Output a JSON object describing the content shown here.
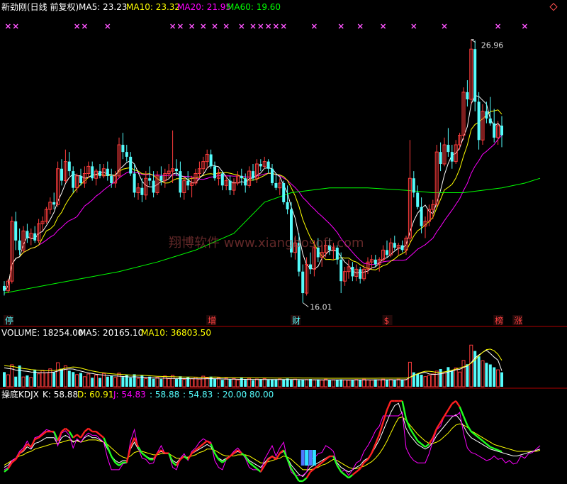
{
  "colors": {
    "bg": "#000000",
    "up": "#ff3c3c",
    "down": "#54fcfc",
    "ma5": "#ffffff",
    "ma10": "#ffff00",
    "ma20": "#ff00ff",
    "ma60": "#00ff00",
    "divider": "#b00000",
    "marker": "#ff55ff",
    "kdj_red": "#ff2020",
    "kdj_green": "#20ff20",
    "kdj_blue": "#5078ff",
    "watermark": "#a05050"
  },
  "header": {
    "name": "新劲刚(日线 前复权)",
    "ma5": "MA5: 23.23",
    "ma10": "MA10: 23.32",
    "ma20": "MA20: 21.95",
    "ma60": "MA60: 19.60"
  },
  "price_panel": {
    "high_label": "26.96",
    "low_label": "16.01",
    "watermark": "翔博软件 www.xiangbosoft.com",
    "event_markers": [
      {
        "label": "停",
        "x_index": 0,
        "color": "#54fcfc"
      },
      {
        "label": "增",
        "x_index": 53,
        "color": "#ff4040"
      },
      {
        "label": "财",
        "x_index": 75,
        "color": "#54fcfc"
      },
      {
        "label": "$",
        "x_index": 99,
        "color": "#ff4040"
      },
      {
        "label": "榜",
        "x_index": 128,
        "color": "#ff4040"
      },
      {
        "label": "涨",
        "x_index": 133,
        "color": "#ff4040"
      }
    ],
    "cross_marker_indices": [
      1,
      3,
      19,
      21,
      27,
      44,
      46,
      49,
      52,
      55,
      58,
      62,
      65,
      67,
      69,
      71,
      73,
      81,
      88,
      93,
      99,
      107,
      115,
      129,
      136
    ]
  },
  "volume_panel": {
    "label": "VOLUME: 18254.00",
    "ma5": "MA5: 20165.10",
    "ma10": "MA10: 36803.50"
  },
  "kdj_panel": {
    "title": "操底KDJX",
    "k": "K: 58.88",
    "d": "D: 60.91",
    "j": "J: 54.83",
    "v1": ": 58.88",
    "v2": ": 54.83",
    "v3": ": 20.00",
    "v4": ": 80.00"
  },
  "chart_data": {
    "type": "candlestick",
    "series_count": 141,
    "ohlc_price_range": [
      15.6,
      28.0
    ],
    "candles": [
      [
        16.7,
        16.9,
        16.3,
        16.5
      ],
      [
        16.5,
        17.0,
        16.4,
        16.9
      ],
      [
        16.9,
        19.6,
        16.8,
        19.4
      ],
      [
        19.4,
        19.8,
        18.2,
        18.6
      ],
      [
        18.6,
        19.1,
        18.0,
        18.2
      ],
      [
        18.2,
        19.2,
        18.1,
        19.0
      ],
      [
        19.0,
        19.3,
        18.5,
        18.7
      ],
      [
        18.7,
        19.1,
        18.4,
        18.9
      ],
      [
        18.9,
        19.2,
        18.5,
        18.6
      ],
      [
        18.6,
        19.5,
        18.5,
        19.3
      ],
      [
        19.3,
        19.6,
        19.0,
        19.4
      ],
      [
        19.4,
        20.0,
        19.3,
        19.9
      ],
      [
        19.9,
        20.4,
        19.7,
        20.2
      ],
      [
        20.2,
        20.6,
        19.9,
        20.1
      ],
      [
        20.1,
        21.9,
        20.0,
        21.6
      ],
      [
        21.6,
        22.0,
        20.9,
        21.1
      ],
      [
        21.1,
        22.4,
        21.0,
        21.9
      ],
      [
        21.9,
        22.3,
        21.3,
        21.5
      ],
      [
        21.5,
        21.7,
        20.6,
        20.8
      ],
      [
        20.8,
        21.4,
        20.6,
        21.3
      ],
      [
        21.3,
        21.6,
        20.9,
        21.0
      ],
      [
        21.0,
        21.7,
        20.8,
        21.4
      ],
      [
        21.4,
        21.9,
        21.2,
        21.7
      ],
      [
        21.7,
        21.9,
        21.1,
        21.2
      ],
      [
        21.2,
        21.6,
        20.9,
        21.5
      ],
      [
        21.5,
        21.8,
        21.2,
        21.3
      ],
      [
        21.3,
        21.8,
        21.2,
        21.6
      ],
      [
        21.6,
        21.9,
        21.1,
        21.3
      ],
      [
        21.3,
        21.6,
        20.8,
        21.0
      ],
      [
        21.0,
        21.5,
        20.8,
        21.3
      ],
      [
        21.3,
        22.9,
        21.2,
        22.6
      ],
      [
        22.6,
        23.1,
        22.0,
        22.3
      ],
      [
        22.3,
        22.6,
        21.9,
        22.1
      ],
      [
        22.1,
        22.3,
        21.3,
        21.4
      ],
      [
        21.4,
        21.8,
        20.4,
        20.6
      ],
      [
        20.6,
        21.0,
        20.3,
        20.8
      ],
      [
        20.8,
        21.2,
        20.2,
        20.5
      ],
      [
        20.5,
        21.5,
        20.3,
        21.2
      ],
      [
        21.2,
        21.7,
        20.9,
        21.1
      ],
      [
        21.1,
        21.5,
        20.4,
        20.6
      ],
      [
        20.6,
        21.5,
        20.5,
        21.3
      ],
      [
        21.3,
        21.7,
        20.9,
        21.1
      ],
      [
        21.1,
        21.6,
        20.8,
        21.4
      ],
      [
        21.4,
        21.8,
        21.2,
        21.5
      ],
      [
        21.5,
        23.2,
        21.0,
        21.6
      ],
      [
        21.6,
        22.0,
        21.3,
        21.5
      ],
      [
        21.5,
        21.9,
        20.4,
        20.6
      ],
      [
        20.6,
        21.3,
        20.3,
        21.1
      ],
      [
        21.1,
        21.5,
        20.7,
        20.9
      ],
      [
        20.9,
        21.3,
        20.4,
        21.0
      ],
      [
        21.0,
        21.6,
        20.9,
        21.4
      ],
      [
        21.4,
        21.9,
        21.2,
        21.6
      ],
      [
        21.6,
        22.1,
        21.4,
        21.9
      ],
      [
        21.9,
        22.4,
        21.6,
        22.2
      ],
      [
        22.2,
        22.4,
        21.6,
        21.7
      ],
      [
        21.7,
        21.9,
        21.1,
        21.2
      ],
      [
        21.2,
        21.6,
        20.9,
        21.4
      ],
      [
        21.4,
        21.5,
        20.7,
        20.9
      ],
      [
        20.9,
        21.3,
        20.7,
        21.1
      ],
      [
        21.1,
        21.3,
        20.5,
        20.7
      ],
      [
        20.7,
        21.2,
        20.5,
        21.0
      ],
      [
        21.0,
        21.5,
        20.9,
        21.3
      ],
      [
        21.3,
        21.6,
        20.9,
        21.2
      ],
      [
        21.2,
        21.4,
        20.6,
        20.9
      ],
      [
        20.9,
        21.7,
        20.8,
        21.5
      ],
      [
        21.5,
        21.8,
        21.1,
        21.2
      ],
      [
        21.2,
        22.0,
        21.0,
        21.8
      ],
      [
        21.8,
        22.0,
        21.5,
        21.7
      ],
      [
        21.7,
        22.1,
        21.6,
        21.9
      ],
      [
        21.9,
        22.0,
        21.4,
        21.6
      ],
      [
        21.6,
        21.8,
        20.9,
        21.0
      ],
      [
        21.0,
        21.4,
        20.7,
        20.8
      ],
      [
        20.8,
        21.2,
        20.5,
        21.0
      ],
      [
        21.0,
        21.1,
        20.1,
        20.2
      ],
      [
        20.2,
        20.9,
        19.7,
        19.9
      ],
      [
        19.9,
        20.2,
        17.9,
        18.1
      ],
      [
        18.1,
        18.8,
        17.8,
        18.5
      ],
      [
        18.5,
        18.9,
        17.1,
        17.3
      ],
      [
        17.3,
        17.6,
        16.0,
        16.4
      ],
      [
        16.4,
        17.9,
        16.3,
        17.6
      ],
      [
        17.6,
        18.1,
        17.2,
        17.4
      ],
      [
        17.4,
        18.6,
        17.1,
        18.3
      ],
      [
        18.3,
        18.7,
        17.7,
        17.9
      ],
      [
        17.9,
        18.4,
        17.5,
        18.1
      ],
      [
        18.1,
        18.6,
        17.9,
        18.4
      ],
      [
        18.4,
        18.7,
        18.0,
        18.2
      ],
      [
        18.2,
        18.5,
        17.8,
        18.3
      ],
      [
        18.3,
        18.4,
        17.6,
        17.8
      ],
      [
        17.8,
        18.1,
        16.4,
        16.9
      ],
      [
        16.9,
        17.5,
        16.7,
        17.3
      ],
      [
        17.3,
        17.8,
        17.0,
        17.5
      ],
      [
        17.5,
        17.7,
        16.9,
        17.1
      ],
      [
        17.1,
        17.6,
        16.9,
        17.4
      ],
      [
        17.4,
        17.5,
        16.8,
        17.0
      ],
      [
        17.0,
        17.6,
        16.9,
        17.4
      ],
      [
        17.4,
        17.9,
        17.2,
        17.7
      ],
      [
        17.7,
        18.0,
        17.4,
        17.8
      ],
      [
        17.8,
        18.0,
        17.5,
        17.6
      ],
      [
        17.6,
        17.9,
        17.3,
        17.8
      ],
      [
        17.8,
        18.4,
        17.7,
        18.2
      ],
      [
        18.2,
        18.6,
        17.9,
        18.0
      ],
      [
        18.0,
        18.7,
        17.9,
        18.5
      ],
      [
        18.5,
        18.8,
        18.2,
        18.3
      ],
      [
        18.3,
        18.5,
        18.0,
        18.4
      ],
      [
        18.4,
        18.6,
        18.1,
        18.2
      ],
      [
        18.2,
        18.8,
        18.0,
        18.7
      ],
      [
        18.7,
        22.8,
        18.5,
        21.2
      ],
      [
        21.2,
        21.5,
        20.4,
        20.6
      ],
      [
        20.6,
        20.9,
        19.9,
        20.0
      ],
      [
        20.0,
        20.4,
        18.9,
        19.2
      ],
      [
        19.2,
        19.6,
        18.7,
        19.4
      ],
      [
        19.4,
        20.1,
        19.2,
        19.9
      ],
      [
        19.9,
        20.3,
        19.5,
        20.1
      ],
      [
        20.1,
        22.6,
        20.0,
        22.3
      ],
      [
        22.3,
        22.7,
        21.5,
        21.8
      ],
      [
        21.8,
        22.9,
        21.7,
        22.6
      ],
      [
        22.6,
        23.3,
        22.1,
        22.3
      ],
      [
        22.3,
        22.6,
        21.6,
        21.9
      ],
      [
        21.9,
        22.8,
        21.8,
        22.6
      ],
      [
        22.6,
        23.1,
        22.4,
        23.0
      ],
      [
        23.0,
        25.0,
        22.8,
        24.8
      ],
      [
        24.8,
        25.3,
        24.2,
        24.5
      ],
      [
        24.5,
        27.0,
        24.3,
        26.6
      ],
      [
        26.6,
        26.96,
        24.0,
        24.4
      ],
      [
        24.4,
        24.8,
        22.4,
        22.8
      ],
      [
        22.8,
        24.3,
        22.6,
        24.0
      ],
      [
        24.0,
        24.4,
        23.5,
        23.7
      ],
      [
        23.7,
        24.6,
        23.4,
        23.5
      ],
      [
        23.5,
        24.1,
        22.7,
        22.9
      ],
      [
        22.9,
        23.6,
        22.6,
        23.4
      ],
      [
        23.4,
        23.8,
        22.5,
        23.0
      ]
    ],
    "volume_range": [
      0,
      60000
    ],
    "volume": [
      18500,
      15200,
      27800,
      12800,
      26800,
      12400,
      14300,
      11800,
      21600,
      16400,
      20800,
      17600,
      22600,
      18200,
      30400,
      22800,
      26400,
      20200,
      18600,
      15400,
      17400,
      12700,
      16200,
      11400,
      14800,
      11200,
      16800,
      12800,
      14200,
      11800,
      17200,
      12400,
      15200,
      11400,
      15800,
      10700,
      14400,
      10400,
      12800,
      10200,
      12000,
      9800,
      13600,
      10200,
      14400,
      9800,
      13200,
      9400,
      12600,
      10100,
      11800,
      9600,
      13400,
      11200,
      12800,
      9800,
      11200,
      8800,
      10800,
      9200,
      10400,
      8400,
      12000,
      8800,
      10600,
      8200,
      9800,
      9600,
      10200,
      8800,
      9400,
      9000,
      9800,
      9200,
      10400,
      8800,
      9600,
      8400,
      8800,
      9200,
      9800,
      8600,
      9200,
      8400,
      9600,
      8200,
      8800,
      9000,
      9400,
      8600,
      8200,
      8400,
      9200,
      8800,
      9600,
      8800,
      8400,
      9200,
      8600,
      9600,
      8800,
      9200,
      8400,
      9600,
      8800,
      9200,
      31000,
      18200,
      16400,
      15200,
      12800,
      14400,
      16200,
      19800,
      22400,
      17600,
      24800,
      20400,
      23800,
      18600,
      33200,
      28400,
      52600,
      45200,
      38400,
      32800,
      30200,
      28200,
      24600,
      21400,
      18254
    ],
    "ma5_volume_line": [
      24000,
      23000,
      22500,
      21000,
      20500,
      20000,
      19400,
      18600,
      18400,
      18000,
      17600,
      17800,
      18200,
      18600,
      19800,
      21000,
      22000,
      22600,
      22400,
      21000,
      19800,
      18600,
      17400,
      16800,
      15800,
      15200,
      14800,
      14200,
      13800,
      13600,
      13400,
      13000,
      12600,
      12400,
      12600,
      12400,
      12200,
      11800,
      11400,
      11200,
      11000,
      10800,
      10800,
      10600,
      10600,
      10400,
      10400,
      10300,
      10200,
      10200,
      10100,
      10000,
      10100,
      10200,
      10300,
      10200,
      10000,
      9900,
      9800,
      9700,
      9600,
      9500,
      9400,
      9400,
      9300,
      9300,
      9200,
      9200,
      9200,
      9100,
      9100,
      9100,
      9100,
      9200,
      9200,
      9200,
      9100,
      9100,
      9000,
      9000,
      8900,
      8900,
      8900,
      8800,
      8800,
      8800,
      8800,
      8800,
      8800,
      8800,
      8800,
      8800,
      8800,
      8800,
      8800,
      8800,
      8800,
      8900,
      8900,
      8900,
      8900,
      8900,
      8900,
      8900,
      8900,
      8900,
      12000,
      14600,
      16200,
      17400,
      18200,
      16200,
      15600,
      15800,
      16400,
      17200,
      18600,
      19800,
      21400,
      22000,
      24400,
      26200,
      30400,
      36400,
      40200,
      43400,
      46200,
      42000,
      37400,
      33600,
      20165
    ],
    "kdj_k": [
      12,
      14,
      18,
      20,
      24,
      26,
      30,
      28,
      33,
      34,
      36,
      38,
      38,
      38,
      32,
      38,
      40,
      38,
      34,
      36,
      34,
      38,
      40,
      38,
      38,
      36,
      34,
      28,
      22,
      18,
      16,
      18,
      18,
      28,
      34,
      28,
      24,
      22,
      20,
      20,
      24,
      26,
      24,
      24,
      18,
      16,
      20,
      22,
      20,
      24,
      26,
      28,
      30,
      32,
      30,
      24,
      20,
      18,
      20,
      22,
      24,
      26,
      24,
      22,
      18,
      16,
      14,
      12,
      16,
      20,
      22,
      20,
      24,
      26,
      20,
      14,
      10,
      6,
      4,
      8,
      12,
      14,
      16,
      18,
      20,
      22,
      22,
      16,
      12,
      10,
      8,
      10,
      12,
      14,
      18,
      20,
      24,
      30,
      36,
      44,
      52,
      60,
      66,
      68,
      58,
      46,
      40,
      36,
      32,
      30,
      28,
      30,
      34,
      40,
      44,
      48,
      52,
      56,
      58,
      54,
      48,
      42,
      38,
      36,
      34,
      32,
      30,
      28,
      27,
      26,
      25,
      24,
      23,
      22,
      22,
      23,
      24,
      25,
      26,
      27,
      28
    ],
    "kdj_d": [
      14,
      16,
      18,
      20,
      22,
      23,
      25,
      26,
      28,
      29,
      30,
      31,
      32,
      33,
      33,
      34,
      35,
      36,
      35,
      35,
      34,
      35,
      36,
      36,
      36,
      35,
      34,
      32,
      29,
      26,
      23,
      21,
      20,
      22,
      25,
      26,
      26,
      25,
      24,
      23,
      23,
      24,
      24,
      24,
      22,
      20,
      20,
      21,
      21,
      22,
      23,
      25,
      26,
      28,
      28,
      27,
      25,
      23,
      22,
      22,
      22,
      23,
      23,
      23,
      22,
      20,
      18,
      16,
      16,
      17,
      18,
      19,
      20,
      22,
      21,
      19,
      16,
      13,
      10,
      10,
      10,
      11,
      12,
      14,
      15,
      17,
      19,
      18,
      16,
      14,
      12,
      11,
      11,
      12,
      13,
      15,
      17,
      20,
      24,
      29,
      35,
      42,
      49,
      55,
      56,
      53,
      49,
      45,
      41,
      38,
      35,
      33,
      33,
      34,
      36,
      39,
      42,
      46,
      49,
      50,
      49,
      47,
      44,
      42,
      40,
      38,
      36,
      34,
      32,
      31,
      30,
      29,
      28,
      27,
      26,
      26,
      26,
      26,
      26,
      26,
      27
    ],
    "ma60_line": [
      [
        0,
        16.4
      ],
      [
        10,
        16.7
      ],
      [
        20,
        17.0
      ],
      [
        30,
        17.3
      ],
      [
        40,
        17.7
      ],
      [
        50,
        18.2
      ],
      [
        60,
        18.9
      ],
      [
        68,
        20.2
      ],
      [
        75,
        20.6
      ],
      [
        85,
        20.8
      ],
      [
        95,
        20.8
      ],
      [
        105,
        20.7
      ],
      [
        112,
        20.6
      ],
      [
        120,
        20.6
      ],
      [
        130,
        20.8
      ],
      [
        136,
        21.0
      ],
      [
        140,
        21.2
      ]
    ]
  }
}
